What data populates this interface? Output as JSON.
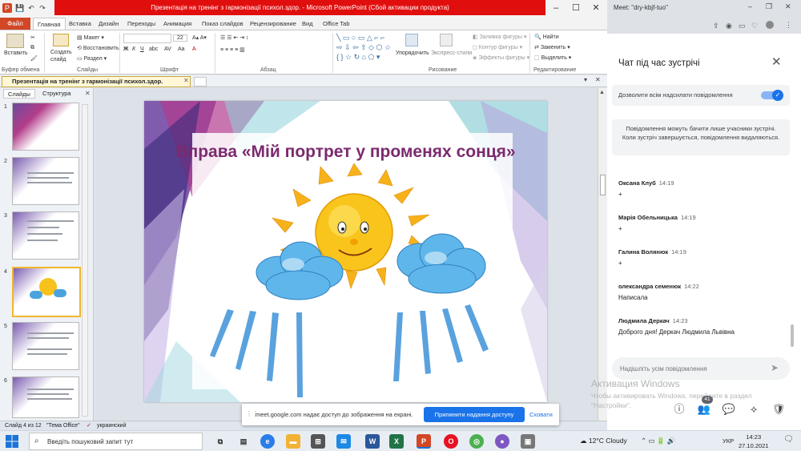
{
  "powerpoint": {
    "window_title": "Презентація на тренінг з гармонізації психол.здор. - Microsoft PowerPoint (Сбой активации продукта)",
    "file_tab": "Файл",
    "tabs": [
      "Главная",
      "Вставка",
      "Дизайн",
      "Переходы",
      "Анимация",
      "Показ слайдов",
      "Рецензирование",
      "Вид",
      "Office Tab"
    ],
    "ribbon": {
      "paste": "Вставить",
      "clipboard_group": "Буфер обмена",
      "create_slide": "Создать слайд",
      "layout": "Макет",
      "reset": "Восстановить",
      "section": "Раздел",
      "slides_group": "Слайды",
      "font_group": "Шрифт",
      "font_size": "22",
      "paragraph_group": "Абзац",
      "arrange": "Упорядочить",
      "quick_styles": "Экспресс-стили",
      "shape_fill": "Заливка фигуры",
      "shape_outline": "Контур фигуры",
      "shape_effects": "Эффекты фигуры",
      "drawing_group": "Рисование",
      "find": "Найти",
      "replace": "Заменить",
      "select": "Выделить",
      "editing_group": "Редактирование"
    },
    "doc_tab": "Презентація на тренінг з гармонізації психол.здор.",
    "panel_tabs": [
      "Слайды",
      "Структура"
    ],
    "thumb_numbers": [
      "1",
      "2",
      "3",
      "4",
      "5",
      "6"
    ],
    "selected_thumb": 4,
    "slide_title": "Вправа «Мій портрет у променях сонця»",
    "status": {
      "slide_info": "Слайд 4 из 12",
      "theme": "\"Тема Office\"",
      "language": "украинский"
    }
  },
  "screen_share": {
    "message": "meet.google.com надає доступ до зображення на екрані.",
    "stop_button": "Припинити надання доступу",
    "cancel_button": "Сховати"
  },
  "chrome": {
    "tab_title": "Meet: \"dry-kbjf-tuo\"",
    "chat_title": "Чат під час зустрічі",
    "allow_label": "Дозволити всім надсилати повідомлення",
    "allow_enabled": true,
    "info": "Повідомлення можуть бачити лише учасники зустрічі. Коли зустріч завершується, повідомлення видаляються.",
    "messages": [
      {
        "name": "Оксана Клуб",
        "time": "14:19",
        "text": "+"
      },
      {
        "name": "Марія Обельницька",
        "time": "14:19",
        "text": "+"
      },
      {
        "name": "Галина Волянюк",
        "time": "14:19",
        "text": "+"
      },
      {
        "name": "олександра семенюк",
        "time": "14:22",
        "text": "Написала"
      },
      {
        "name": "Людмила Деркач",
        "time": "14:23",
        "text": "Доброго дня!  Деркач Людмила Львівна"
      }
    ],
    "input_placeholder": "Надішліть усім повідомлення",
    "participants_badge": "41",
    "watermark_title": "Активация Windows",
    "watermark_text": "Чтобы активировать Windows, перейдите в раздел \"Настройки\"."
  },
  "taskbar": {
    "search_placeholder": "Введіть пошуковий запит тут",
    "weather": "12°C  Cloudy",
    "language": "УКР",
    "time": "14:23",
    "date": "27.10.2021"
  },
  "colors": {
    "ppt_accent": "#d24726",
    "title_red": "#e10e0e",
    "meet_blue": "#1a73e8",
    "slide_title": "#7b2a6e"
  }
}
